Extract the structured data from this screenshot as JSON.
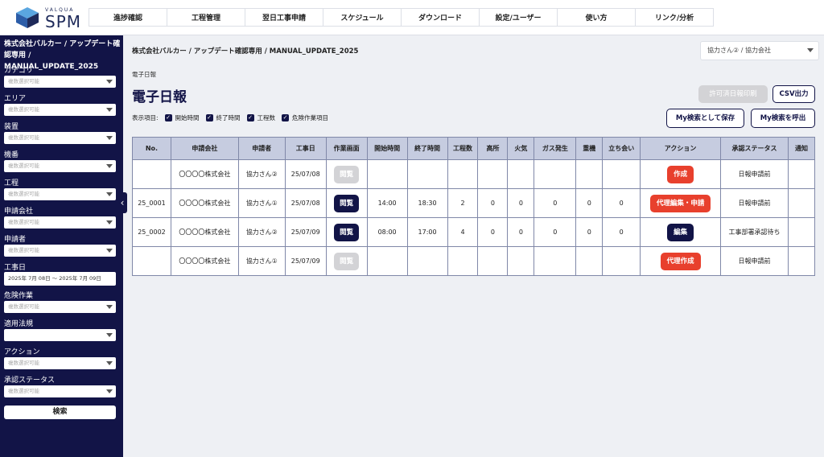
{
  "logo": {
    "small": "VALQUA",
    "big": "SPM"
  },
  "nav": [
    "進捗確認",
    "工程管理",
    "翌日工事申請",
    "スケジュール",
    "ダウンロード",
    "設定/ユーザー",
    "使い方",
    "リンク/分析"
  ],
  "sidebar": {
    "company": "株式会社バルカー / アップデート確認専用 / MANUAL_UPDATE_2025",
    "filters": [
      {
        "label": "カテゴリ",
        "placeholder": "複数選択可能"
      },
      {
        "label": "エリア",
        "placeholder": "複数選択可能"
      },
      {
        "label": "装置",
        "placeholder": "複数選択可能"
      },
      {
        "label": "機番",
        "placeholder": "複数選択可能"
      },
      {
        "label": "工程",
        "placeholder": "複数選択可能"
      },
      {
        "label": "申請会社",
        "placeholder": "複数選択可能"
      },
      {
        "label": "申請者",
        "placeholder": "複数選択可能"
      },
      {
        "label": "工事日",
        "placeholder": "2025年 7月 08日 〜 2025年 7月 09日"
      },
      {
        "label": "危険作業",
        "placeholder": "複数選択可能"
      },
      {
        "label": "適用法規",
        "placeholder": ""
      },
      {
        "label": "アクション",
        "placeholder": "複数選択可能"
      },
      {
        "label": "承認ステータス",
        "placeholder": "複数選択可能"
      }
    ],
    "search_label": "検索",
    "collapse_glyph": "‹"
  },
  "main": {
    "breadcrumb": "株式会社バルカー / アップデート確認専用 / MANUAL_UPDATE_2025",
    "user_select": "協力さん② / 協力会社",
    "subtitle": "電子日報",
    "title": "電子日報",
    "display_items_label": "表示項目:",
    "display_items": [
      "開始時間",
      "終了時間",
      "工程数",
      "危険作業項目"
    ],
    "print_label": "許可済日報印刷",
    "csv_label": "CSV出力",
    "save_search_label": "My検索として保存",
    "load_search_label": "My検索を呼出"
  },
  "table": {
    "headers": [
      "No.",
      "申請会社",
      "申請者",
      "工事日",
      "作業画面",
      "開始時間",
      "終了時間",
      "工程数",
      "高所",
      "火気",
      "ガス発生",
      "重機",
      "立ち会い",
      "アクション",
      "承認ステータス",
      "通知"
    ],
    "rows": [
      {
        "no": "",
        "company": "〇〇〇〇株式会社",
        "applicant": "協力さん②",
        "date": "25/07/08",
        "view": "閲覧",
        "view_enabled": false,
        "start": "",
        "end": "",
        "steps": "",
        "height": "",
        "fire": "",
        "gas": "",
        "heavy": "",
        "witness": "",
        "action": "作成",
        "action_color": "red",
        "status": "日報申請前",
        "notice": ""
      },
      {
        "no": "25_0001",
        "company": "〇〇〇〇株式会社",
        "applicant": "協力さん①",
        "date": "25/07/08",
        "view": "閲覧",
        "view_enabled": true,
        "start": "14:00",
        "end": "18:30",
        "steps": "2",
        "height": "0",
        "fire": "0",
        "gas": "0",
        "heavy": "0",
        "witness": "0",
        "action": "代理編集・申請",
        "action_color": "red",
        "status": "日報申請前",
        "notice": ""
      },
      {
        "no": "25_0002",
        "company": "〇〇〇〇株式会社",
        "applicant": "協力さん②",
        "date": "25/07/09",
        "view": "閲覧",
        "view_enabled": true,
        "start": "08:00",
        "end": "17:00",
        "steps": "4",
        "height": "0",
        "fire": "0",
        "gas": "0",
        "heavy": "0",
        "witness": "0",
        "action": "編集",
        "action_color": "navy",
        "status": "工事部署承認待ち",
        "notice": ""
      },
      {
        "no": "",
        "company": "〇〇〇〇株式会社",
        "applicant": "協力さん①",
        "date": "25/07/09",
        "view": "閲覧",
        "view_enabled": false,
        "start": "",
        "end": "",
        "steps": "",
        "height": "",
        "fire": "",
        "gas": "",
        "heavy": "",
        "witness": "",
        "action": "代理作成",
        "action_color": "red",
        "status": "日報申請前",
        "notice": ""
      }
    ]
  }
}
